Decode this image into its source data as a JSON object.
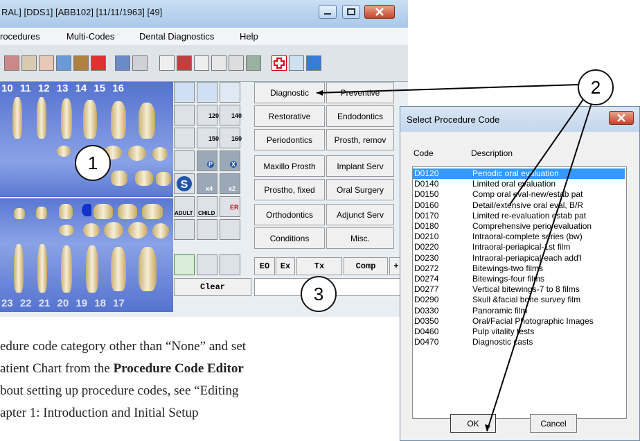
{
  "window": {
    "title": "RAL] [DDS1] [ABB102] [11/11/1963] [49]"
  },
  "menu": [
    "rocedures",
    "Multi-Codes",
    "Dental Diagnostics",
    "Help"
  ],
  "chart": {
    "top_numbers": "10  11  12  13  14  15  16",
    "bottom_numbers": "23  22  21  20  19  18  17"
  },
  "icon_labels": {
    "x120": "120",
    "x140": "140",
    "x150": "150",
    "x160": "160",
    "p": "P",
    "x": "X",
    "x4": "x4",
    "x2": "x2",
    "adult": "ADULT",
    "child": "CHILD",
    "er": "ER"
  },
  "categories": [
    [
      "Diagnostic",
      "Preventive"
    ],
    [
      "Restorative",
      "Endodontics"
    ],
    [
      "Periodontics",
      "Prosth, remov"
    ],
    [
      "Maxillo Prosth",
      "Implant Serv"
    ],
    [
      "Prostho, fixed",
      "Oral Surgery"
    ],
    [
      "Orthodontics",
      "Adjunct Serv"
    ],
    [
      "Conditions",
      "Misc."
    ]
  ],
  "bottom_buttons": [
    "EO",
    "Ex",
    "Tx",
    "Comp",
    "+"
  ],
  "clear_label": "Clear",
  "callouts": [
    "1",
    "2",
    "3"
  ],
  "dialog": {
    "title": "Select Procedure Code",
    "col_code": "Code",
    "col_desc": "Description",
    "ok": "OK",
    "cancel": "Cancel",
    "rows": [
      {
        "code": "D0120",
        "desc": "Periodic oral evaluation",
        "selected": true
      },
      {
        "code": "D0140",
        "desc": "Limited oral evaluation"
      },
      {
        "code": "D0150",
        "desc": "Comp oral eval-new/estab pat"
      },
      {
        "code": "D0160",
        "desc": "Detail/extensive oral eval, B/R"
      },
      {
        "code": "D0170",
        "desc": "Limited re-evaluation estab pat"
      },
      {
        "code": "D0180",
        "desc": "Comprehensive perio evaluation"
      },
      {
        "code": "D0210",
        "desc": "Intraoral-complete series (bw)"
      },
      {
        "code": "D0220",
        "desc": "Intraoral-periapical-1st film"
      },
      {
        "code": "D0230",
        "desc": "Intraoral-periapical-each add'l"
      },
      {
        "code": "D0272",
        "desc": "Bitewings-two films"
      },
      {
        "code": "D0274",
        "desc": "Bitewings-four films"
      },
      {
        "code": "D0277",
        "desc": "Vertical bitewings-7 to 8 films"
      },
      {
        "code": "D0290",
        "desc": "Skull &facial bone survey film"
      },
      {
        "code": "D0330",
        "desc": "Panoramic film"
      },
      {
        "code": "D0350",
        "desc": "Oral/Facial Photographic Images"
      },
      {
        "code": "D0460",
        "desc": "Pulp vitality tests"
      },
      {
        "code": "D0470",
        "desc": "Diagnostic casts"
      }
    ]
  },
  "doc_text": {
    "line1": "edure code category other than “None” and set",
    "line2_a": "atient Chart from the ",
    "line2_b": "Procedure Code Editor",
    "line3": "bout setting up procedure codes, see “Editing",
    "line4": "apter 1: Introduction and Initial Setup"
  }
}
